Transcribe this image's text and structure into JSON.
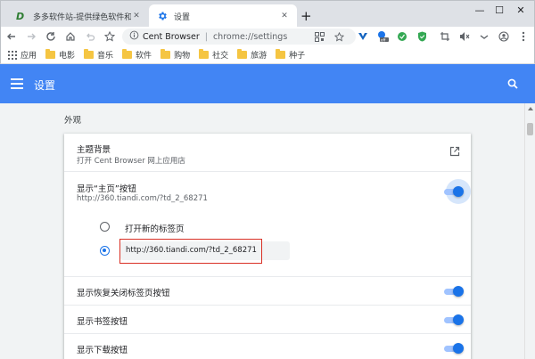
{
  "tabs": [
    {
      "title": "多多软件站-提供绿色软件和热门单机",
      "icon": "dd-logo-icon"
    },
    {
      "title": "设置",
      "icon": "gear-icon"
    }
  ],
  "toolbar": {
    "site_name": "Cent Browser",
    "url": "chrome://settings"
  },
  "bookmarks": [
    {
      "label": "应用",
      "icon": "apps-grid-icon"
    },
    {
      "label": "电影",
      "icon": "folder-icon"
    },
    {
      "label": "音乐",
      "icon": "folder-icon"
    },
    {
      "label": "软件",
      "icon": "folder-icon"
    },
    {
      "label": "购物",
      "icon": "folder-icon"
    },
    {
      "label": "社交",
      "icon": "folder-icon"
    },
    {
      "label": "旅游",
      "icon": "folder-icon"
    },
    {
      "label": "种子",
      "icon": "folder-icon"
    }
  ],
  "header": {
    "title": "设置"
  },
  "appearance": {
    "section_title": "外观",
    "theme_label": "主题背景",
    "theme_sub": "打开 Cent Browser 网上应用店",
    "home_label": "显示“主页”按钮",
    "home_sub": "http://360.tiandi.com/?td_2_68271",
    "home_enabled": true,
    "radio_newtab_label": "打开新的标签页",
    "radio_custom_value": "http://360.tiandi.com/?td_2_68271",
    "radio_selected": "custom",
    "restore_label": "显示恢复关闭标签页按钮",
    "restore_enabled": true,
    "bookmark_label": "显示书签按钮",
    "bookmark_enabled": true,
    "download_label": "显示下载按钮",
    "download_enabled": true
  },
  "colors": {
    "header_blue": "#4285f4",
    "toggle_blue": "#1a73e8",
    "highlight_red": "#d93025"
  }
}
